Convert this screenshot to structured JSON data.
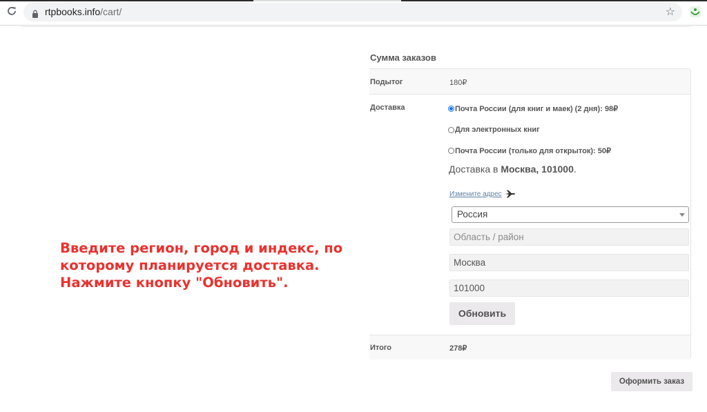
{
  "browser": {
    "url_host": "rtpbooks.info",
    "url_path": "/cart/",
    "icons": [
      "reload-icon",
      "lock-icon",
      "star-icon",
      "extension-icon"
    ]
  },
  "instruction": {
    "lines": [
      "Введите регион, город и индекс, по",
      "которому планируется доставка.",
      "Нажмите кнопку \"Обновить\"."
    ],
    "color": "#e8322f"
  },
  "cart_totals": {
    "heading": "Сумма заказов",
    "subtotal_label": "Подытог",
    "subtotal_value": "180₽",
    "shipping_label": "Доставка",
    "shipping_options": [
      {
        "label": "Почта России (для книг и маек) (2 дня): 98₽",
        "selected": true
      },
      {
        "label": "Для электронных книг",
        "selected": false
      },
      {
        "label": "Почта России (только для открыток): 50₽",
        "selected": false
      }
    ],
    "destination_prefix": "Доставка в ",
    "destination_value": "Москва, 101000",
    "destination_suffix": ".",
    "change_address_label": "Измените адрес",
    "country_value": "Россия",
    "region_placeholder": "Область / район",
    "city_value": "Москва",
    "postcode_value": "101000",
    "update_button_label": "Обновить",
    "total_label": "Итого",
    "total_value": "278₽"
  },
  "checkout_button_label": "Оформить заказ",
  "accent_color": "#1a73e8"
}
